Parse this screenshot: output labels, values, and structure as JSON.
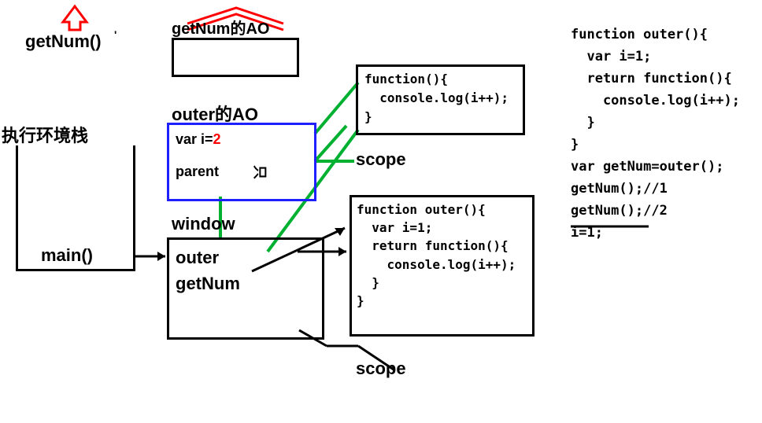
{
  "labels": {
    "getNum_top": "getNum()",
    "getNum_ao": "getNum的AO",
    "outer_ao": "outer的AO",
    "exec_stack": "执行环境栈",
    "main": "main()",
    "window": "window",
    "outer_word": "outer",
    "getNum_word": "getNum",
    "scope_top": "scope",
    "scope_bottom": "scope",
    "var_i_prefix": "var  i=",
    "var_i_value": "2",
    "parent": "parent",
    "stick_fig": "只"
  },
  "code": {
    "inner_func": "function(){\n  console.log(i++);\n}",
    "outer_func": "function outer(){\n  var i=1;\n  return function(){\n    console.log(i++);\n  }\n}",
    "right_block": "function outer(){\n  var i=1;\n  return function(){\n    console.log(i++);\n  }\n}\nvar getNum=outer();\ngetNum();//1\ngetNum();//2\ni=1;"
  }
}
